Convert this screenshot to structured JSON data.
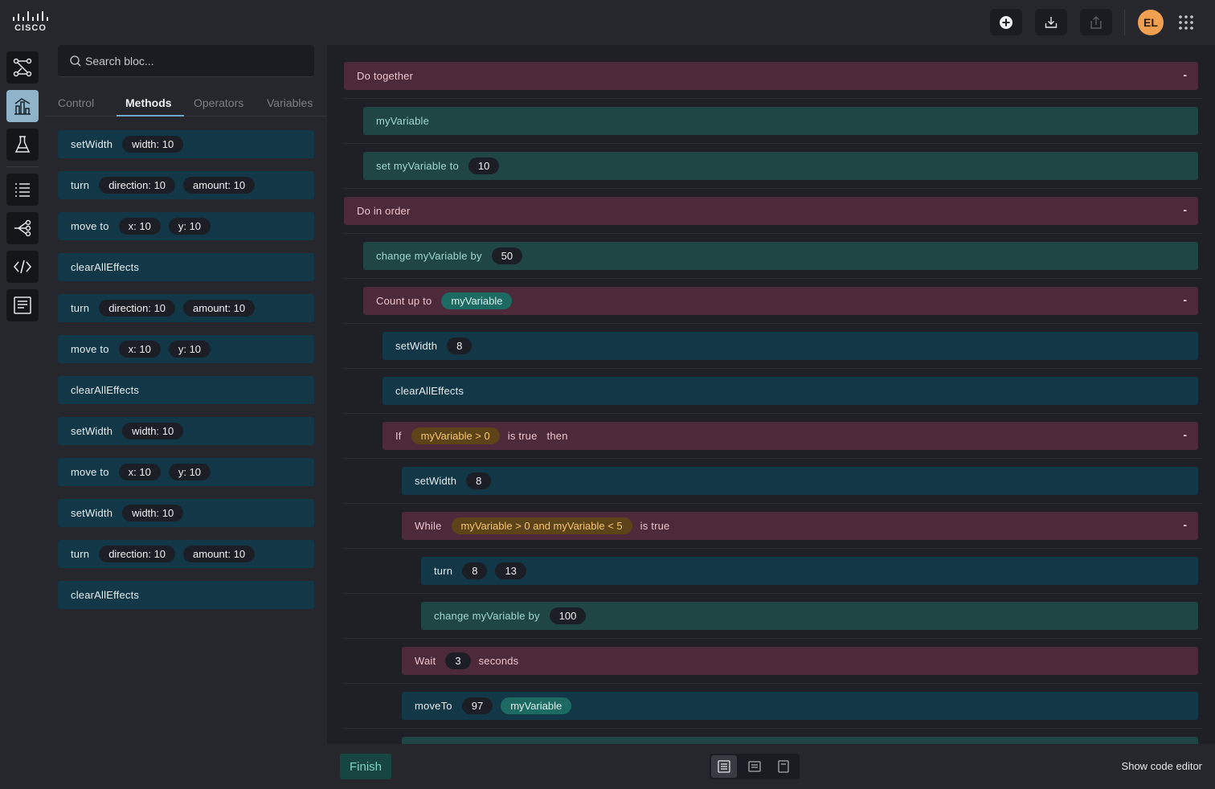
{
  "brand": {
    "logo_text": "CISCO"
  },
  "header": {
    "add_icon": "plus-circle-icon",
    "download_icon": "download-icon",
    "share_icon": "share-icon",
    "user_initials": "EL",
    "apps_icon": "apps-grid-icon"
  },
  "nav": {
    "items": [
      {
        "icon": "workflow-icon"
      },
      {
        "icon": "blocks-icon",
        "active": true
      },
      {
        "icon": "flask-icon"
      },
      {
        "icon": "list-icon"
      },
      {
        "icon": "share-nodes-icon"
      },
      {
        "icon": "code-icon"
      },
      {
        "icon": "document-icon"
      }
    ]
  },
  "palette": {
    "search_placeholder": "Search bloc...",
    "tabs": [
      "Control",
      "Methods",
      "Operators",
      "Variables"
    ],
    "active_tab": "Methods",
    "blocks": [
      {
        "label": "setWidth",
        "params": [
          "width: 10"
        ]
      },
      {
        "label": "turn",
        "params": [
          "direction: 10",
          "amount: 10"
        ]
      },
      {
        "label": "move to",
        "params": [
          "x: 10",
          "y: 10"
        ]
      },
      {
        "label": "clearAllEffects",
        "params": []
      },
      {
        "label": "turn",
        "params": [
          "direction: 10",
          "amount: 10"
        ]
      },
      {
        "label": "move to",
        "params": [
          "x: 10",
          "y: 10"
        ]
      },
      {
        "label": "clearAllEffects",
        "params": []
      },
      {
        "label": "setWidth",
        "params": [
          "width: 10"
        ]
      },
      {
        "label": "move to",
        "params": [
          "x: 10",
          "y: 10"
        ]
      },
      {
        "label": "setWidth",
        "params": [
          "width: 10"
        ]
      },
      {
        "label": "turn",
        "params": [
          "direction: 10",
          "amount: 10"
        ]
      },
      {
        "label": "clearAllEffects",
        "params": []
      }
    ]
  },
  "program": {
    "blocks": [
      {
        "kind": "ctrl",
        "depth": 0,
        "parts": [
          {
            "t": "label",
            "v": "Do together"
          }
        ],
        "collapse": "-"
      },
      {
        "kind": "var",
        "depth": 1,
        "parts": [
          {
            "t": "label",
            "v": "myVariable"
          }
        ]
      },
      {
        "kind": "var",
        "depth": 1,
        "parts": [
          {
            "t": "label",
            "v": "set myVariable to"
          },
          {
            "t": "pill",
            "v": "10"
          }
        ]
      },
      {
        "kind": "ctrl",
        "depth": 0,
        "parts": [
          {
            "t": "label",
            "v": "Do in order"
          }
        ],
        "collapse": "-"
      },
      {
        "kind": "var",
        "depth": 1,
        "parts": [
          {
            "t": "label",
            "v": "change myVariable by"
          },
          {
            "t": "pill",
            "v": "50"
          }
        ]
      },
      {
        "kind": "ctrl",
        "depth": 1,
        "parts": [
          {
            "t": "label",
            "v": "Count up to"
          },
          {
            "t": "teal",
            "v": "myVariable"
          }
        ],
        "collapse": "-"
      },
      {
        "kind": "meth",
        "depth": 2,
        "parts": [
          {
            "t": "label",
            "v": "setWidth"
          },
          {
            "t": "pill",
            "v": "8"
          }
        ]
      },
      {
        "kind": "meth",
        "depth": 2,
        "parts": [
          {
            "t": "label",
            "v": "clearAllEffects"
          }
        ]
      },
      {
        "kind": "ctrl",
        "depth": 2,
        "parts": [
          {
            "t": "label",
            "v": "If"
          },
          {
            "t": "amber",
            "v": "myVariable > 0"
          },
          {
            "t": "label",
            "v": "is true"
          },
          {
            "t": "label",
            "v": "then"
          }
        ],
        "collapse": "-"
      },
      {
        "kind": "meth",
        "depth": 3,
        "parts": [
          {
            "t": "label",
            "v": "setWidth"
          },
          {
            "t": "pill",
            "v": "8"
          }
        ]
      },
      {
        "kind": "ctrl",
        "depth": 3,
        "parts": [
          {
            "t": "label",
            "v": "While"
          },
          {
            "t": "amber",
            "v": "myVariable > 0 and myVariable < 5"
          },
          {
            "t": "label",
            "v": "is true"
          }
        ],
        "collapse": "-"
      },
      {
        "kind": "meth",
        "depth": 4,
        "parts": [
          {
            "t": "label",
            "v": "turn"
          },
          {
            "t": "pill",
            "v": "8"
          },
          {
            "t": "pill",
            "v": "13"
          }
        ]
      },
      {
        "kind": "var",
        "depth": 4,
        "parts": [
          {
            "t": "label",
            "v": "change myVariable by"
          },
          {
            "t": "pill",
            "v": "100"
          }
        ]
      },
      {
        "kind": "ctrl",
        "depth": 3,
        "parts": [
          {
            "t": "label",
            "v": "Wait"
          },
          {
            "t": "pill",
            "v": "3"
          },
          {
            "t": "label",
            "v": "seconds"
          }
        ]
      },
      {
        "kind": "meth",
        "depth": 3,
        "parts": [
          {
            "t": "label",
            "v": "moveTo"
          },
          {
            "t": "pill",
            "v": "97"
          },
          {
            "t": "teal",
            "v": "myVariable"
          }
        ]
      },
      {
        "kind": "var",
        "depth": 3,
        "parts": []
      }
    ]
  },
  "footer": {
    "finish_label": "Finish",
    "view_modes": [
      "view-full-icon",
      "view-compact-icon",
      "view-minimal-icon"
    ],
    "show_code_label": "Show code editor"
  }
}
